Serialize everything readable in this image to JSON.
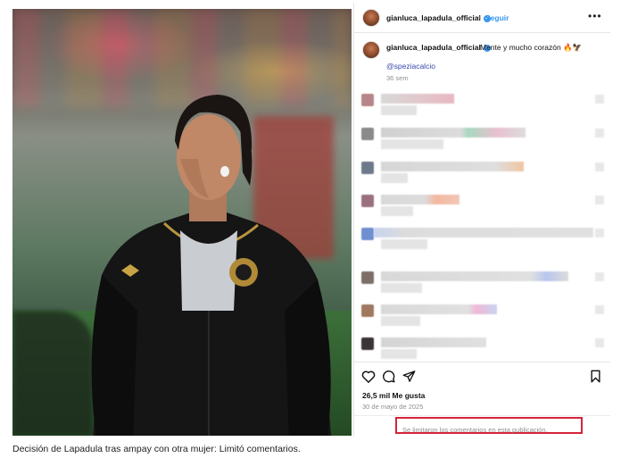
{
  "post": {
    "username": "gianluca_lapadula_official",
    "follow_label": "Seguir",
    "more_label": "•••",
    "separator": "•",
    "verified_mark": "✓",
    "caption": "Mente y mucho corazón 🔥🦅",
    "mention": "@speziacalcio",
    "time_ago": "36 sem",
    "likes": "26,5 mil Me gusta",
    "date": "30 de mayo de 2025",
    "comments_limited_notice": "Se limitaron los comentarios en esta publicación."
  },
  "page_caption": "Decisión de Lapadula tras ampay con otra mujer: Limitó comentarios.",
  "icons": {
    "like": "heart-icon",
    "comment": "comment-icon",
    "share": "share-icon",
    "save": "bookmark-icon"
  },
  "colors": {
    "accent_blue": "#3897f0",
    "highlight_red": "#d4243a",
    "muted_gray": "#8e8e8e"
  }
}
